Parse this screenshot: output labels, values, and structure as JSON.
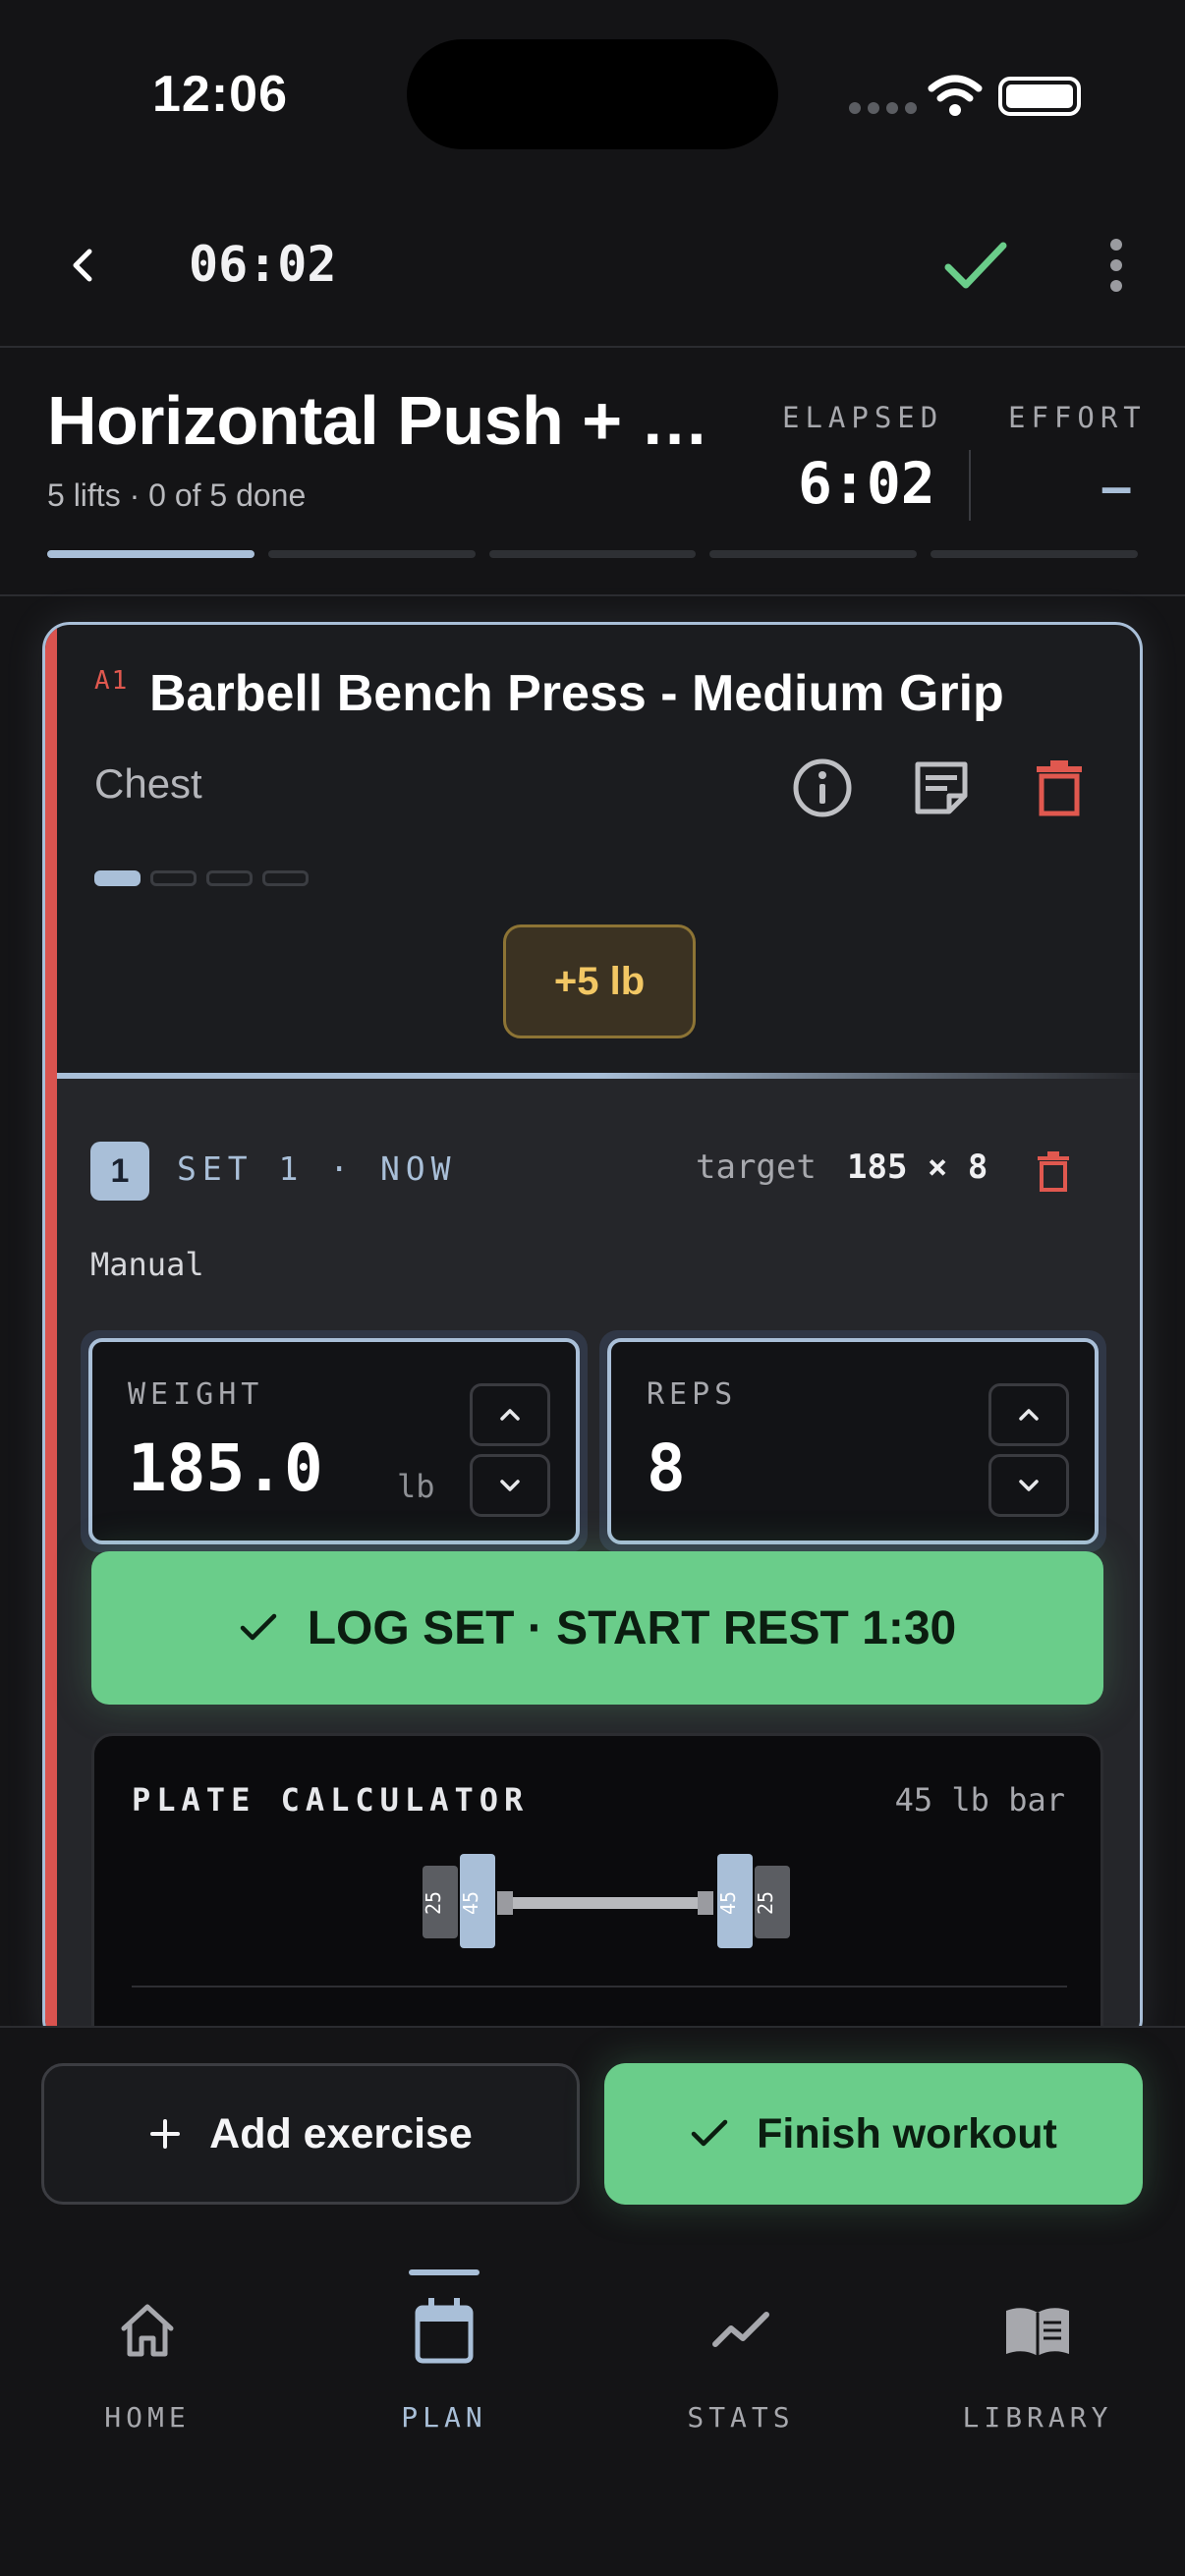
{
  "status_bar": {
    "time": "12:06"
  },
  "top_bar": {
    "timer": "06:02"
  },
  "workout": {
    "title": "Horizontal Push + Pull",
    "subtitle": "5 lifts · 0 of 5 done",
    "elapsed_label": "ELAPSED",
    "elapsed_value": "6:02",
    "effort_label": "EFFORT",
    "effort_value": "–",
    "progress_segments": 5,
    "progress_done_fraction": 0.2
  },
  "exercise": {
    "code": "A1",
    "name": "Barbell Bench Press - Medium Grip",
    "muscle": "Chest",
    "sets_total": 4,
    "current_set_index": 1,
    "increment_label": "+5 lb"
  },
  "set": {
    "number": "1",
    "status": "SET 1 · NOW",
    "target_label": "target",
    "target_value": "185 × 8",
    "mode": "Manual",
    "weight": {
      "label": "WEIGHT",
      "value": "185.0",
      "unit": "lb"
    },
    "reps": {
      "label": "REPS",
      "value": "8"
    },
    "log_button": "LOG SET · START REST 1:30"
  },
  "plate_calculator": {
    "title": "PLATE CALCULATOR",
    "bar_label": "45 lb bar",
    "plates_per_side": [
      "45",
      "25"
    ]
  },
  "actions": {
    "add_exercise": "Add exercise",
    "finish_workout": "Finish workout"
  },
  "tabs": [
    {
      "label": "HOME",
      "icon": "home-icon",
      "active": false
    },
    {
      "label": "PLAN",
      "icon": "calendar-icon",
      "active": true
    },
    {
      "label": "STATS",
      "icon": "trend-icon",
      "active": false
    },
    {
      "label": "LIBRARY",
      "icon": "book-icon",
      "active": false
    }
  ],
  "colors": {
    "accent": "#a9bfd8",
    "success": "#6acd8a",
    "danger": "#e0584f",
    "warning": "#f2c764",
    "background": "#141416"
  }
}
